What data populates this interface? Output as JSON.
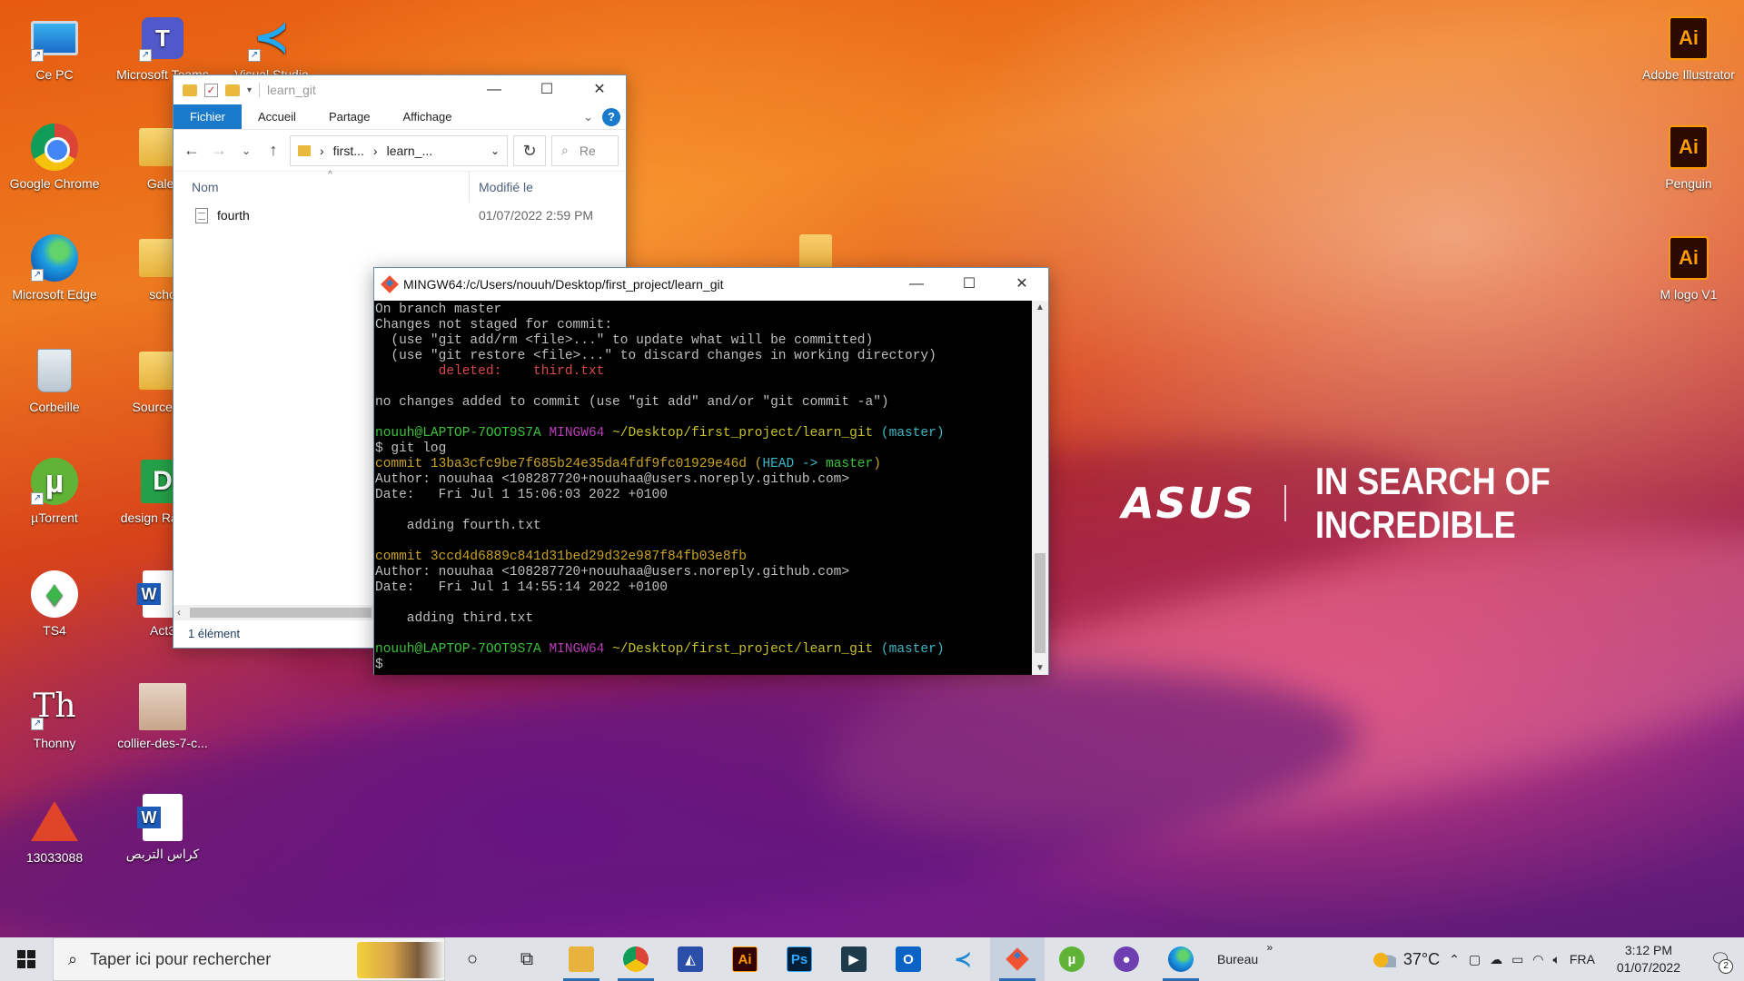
{
  "desktop": {
    "icons": [
      {
        "label": "Ce PC",
        "icon": "computer-icon"
      },
      {
        "label": "Microsoft Teams",
        "icon": "teams-icon"
      },
      {
        "label": "Visual Studio",
        "icon": "vscode-icon"
      },
      {
        "label": "Google Chrome",
        "icon": "chrome-icon"
      },
      {
        "label": "Galer",
        "icon": "folder-icon"
      },
      {
        "label": "Microsoft Edge",
        "icon": "edge-icon"
      },
      {
        "label": "scho",
        "icon": "folder-icon"
      },
      {
        "label": "Corbeille",
        "icon": "recycle-bin-icon"
      },
      {
        "label": "SourceFile",
        "icon": "folder-icon"
      },
      {
        "label": "µTorrent",
        "icon": "utorrent-icon"
      },
      {
        "label": "design Raccou",
        "icon": "green-app-icon"
      },
      {
        "label": "TS4",
        "icon": "sims4-icon"
      },
      {
        "label": "Act3",
        "icon": "word-icon"
      },
      {
        "label": "Thonny",
        "icon": "thonny-icon"
      },
      {
        "label": "collier-des-7-c...",
        "icon": "photo-icon"
      },
      {
        "label": "13033088",
        "icon": "pyramid-icon"
      },
      {
        "label": "كراس التربص",
        "icon": "word-icon"
      },
      {
        "label": "Adobe Illustrator",
        "icon": "illustrator-icon"
      },
      {
        "label": "Penguin",
        "icon": "illustrator-file-icon"
      },
      {
        "label": "M logo V1",
        "icon": "illustrator-file-icon"
      }
    ],
    "wallpaper": {
      "brand": "ASUS",
      "tagline": "IN SEARCH OF INCREDIBLE"
    }
  },
  "explorer": {
    "title": "learn_git",
    "ribbon_tabs": [
      "Fichier",
      "Accueil",
      "Partage",
      "Affichage"
    ],
    "address": {
      "part1": "first...",
      "part2": "learn_..."
    },
    "search_placeholder": "Re",
    "columns": {
      "name": "Nom",
      "modified": "Modifié le"
    },
    "files": [
      {
        "name": "fourth",
        "modified": "01/07/2022 2:59 PM"
      }
    ],
    "status": "1 élément",
    "accent_color": "#1979ca"
  },
  "gitbash": {
    "title": "MINGW64:/c/Users/nouuh/Desktop/first_project/learn_git",
    "lines": {
      "l1": "On branch master",
      "l2": "Changes not staged for commit:",
      "l3": "  (use \"git add/rm <file>...\" to update what will be committed)",
      "l4": "  (use \"git restore <file>...\" to discard changes in working directory)",
      "l5_label": "        deleted:    ",
      "l5_file": "third.txt",
      "l6": "no changes added to commit (use \"git add\" and/or \"git commit -a\")",
      "prompt_user": "nouuh@LAPTOP-7OOT9S7A",
      "prompt_env": "MINGW64",
      "prompt_path": "~/Desktop/first_project/learn_git",
      "prompt_branch": "(master)",
      "cmd": "$ git log",
      "c1_hash": "commit 13ba3cfc9be7f685b24e35da4fdf9fc01929e46d",
      "c1_open": "(",
      "c1_head": "HEAD -> ",
      "c1_branch": "master",
      "c1_close": ")",
      "c1_author": "Author: nouuhaa <108287720+nouuhaa@users.noreply.github.com>",
      "c1_date": "Date:   Fri Jul 1 15:06:03 2022 +0100",
      "c1_msg": "    adding fourth.txt",
      "c2_hash": "commit 3ccd4d6889c841d31bed29d32e987f84fb03e8fb",
      "c2_author": "Author: nouuhaa <108287720+nouuhaa@users.noreply.github.com>",
      "c2_date": "Date:   Fri Jul 1 14:55:14 2022 +0100",
      "c2_msg": "    adding third.txt",
      "last_prompt": "$"
    }
  },
  "taskbar": {
    "search_placeholder": "Taper ici pour rechercher",
    "apps": [
      {
        "name": "task-view",
        "icon": "task-view-icon"
      },
      {
        "name": "file-explorer",
        "icon": "folder-icon"
      },
      {
        "name": "chrome",
        "icon": "chrome-icon"
      },
      {
        "name": "affinity",
        "icon": "affinity-icon"
      },
      {
        "name": "illustrator",
        "icon": "illustrator-icon",
        "label": "Ai"
      },
      {
        "name": "photoshop",
        "icon": "photoshop-icon",
        "label": "Ps"
      },
      {
        "name": "terminal-app",
        "icon": "terminal-icon"
      },
      {
        "name": "outlook",
        "icon": "outlook-icon"
      },
      {
        "name": "vscode",
        "icon": "vscode-icon"
      },
      {
        "name": "git",
        "icon": "git-icon"
      },
      {
        "name": "utorrent",
        "icon": "utorrent-icon"
      },
      {
        "name": "github",
        "icon": "github-icon"
      },
      {
        "name": "edge",
        "icon": "edge-icon"
      }
    ],
    "bureau_label": "Bureau",
    "temperature": "37°C",
    "language": "FRA",
    "time": "3:12 PM",
    "date": "01/07/2022",
    "notifications": "2"
  }
}
